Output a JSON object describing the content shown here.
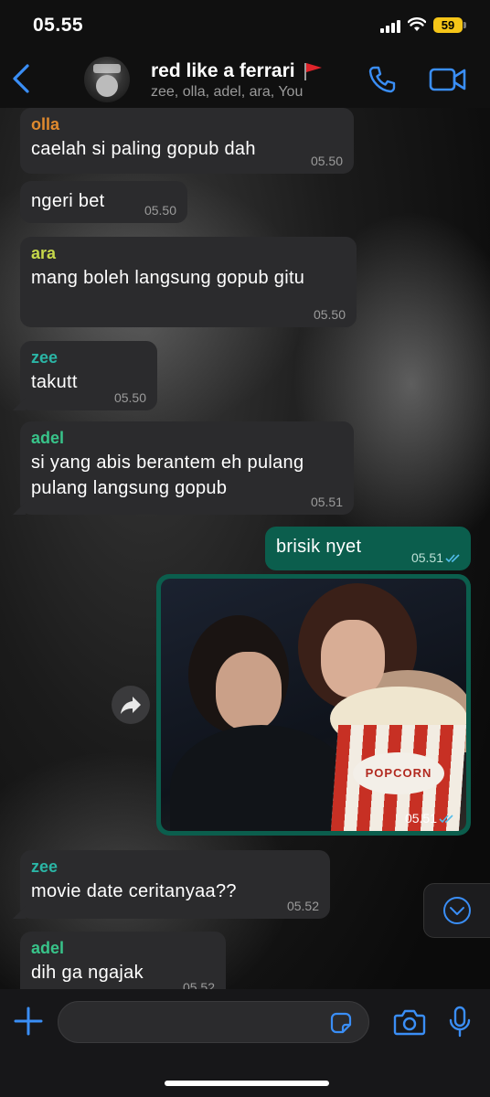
{
  "status_bar": {
    "time": "05.55",
    "battery": "59",
    "icons": [
      "signal-icon",
      "wifi-icon",
      "battery-icon"
    ]
  },
  "header": {
    "title": "red like a ferrari",
    "title_emoji": "triangular-flag-icon",
    "subtitle": "zee, olla, adel, ara, You",
    "icons": [
      "back-chevron-icon",
      "group-avatar",
      "phone-icon",
      "video-camera-icon"
    ]
  },
  "colors": {
    "accent_blue": "#3a8ef6",
    "incoming_bubble": "#2b2b2d",
    "outgoing_bubble": "#0b5e4d",
    "name_olla": "#e08a2e",
    "name_ara": "#c6d84a",
    "name_zee": "#2bb5a5",
    "name_adel": "#38c48a",
    "read_tick": "#53bdeb"
  },
  "messages": [
    {
      "sender": "olla",
      "text": "caelah si paling gopub dah",
      "time": "05.50"
    },
    {
      "sender": "",
      "text": "ngeri bet",
      "time": "05.50"
    },
    {
      "sender": "ara",
      "text": "mang boleh langsung gopub gitu",
      "time": "05.50"
    },
    {
      "sender": "zee",
      "text": "takutt",
      "time": "05.50"
    },
    {
      "sender": "adel",
      "text": "si yang abis berantem eh pulang pulang langsung gopub",
      "time": "05.51"
    },
    {
      "sender": "You",
      "text": "brisik nyet",
      "time": "05.51"
    },
    {
      "sender": "You",
      "type": "photo",
      "photo_text": "POPCORN",
      "time": "05.51"
    },
    {
      "sender": "zee",
      "text": "movie date ceritanyaa??",
      "time": "05.52"
    },
    {
      "sender": "adel",
      "text": "dih ga ngajak",
      "time": "05.52"
    }
  ],
  "input": {
    "placeholder": "",
    "value": "",
    "icons": [
      "plus-icon",
      "sticker-icon",
      "camera-icon",
      "microphone-icon"
    ]
  }
}
